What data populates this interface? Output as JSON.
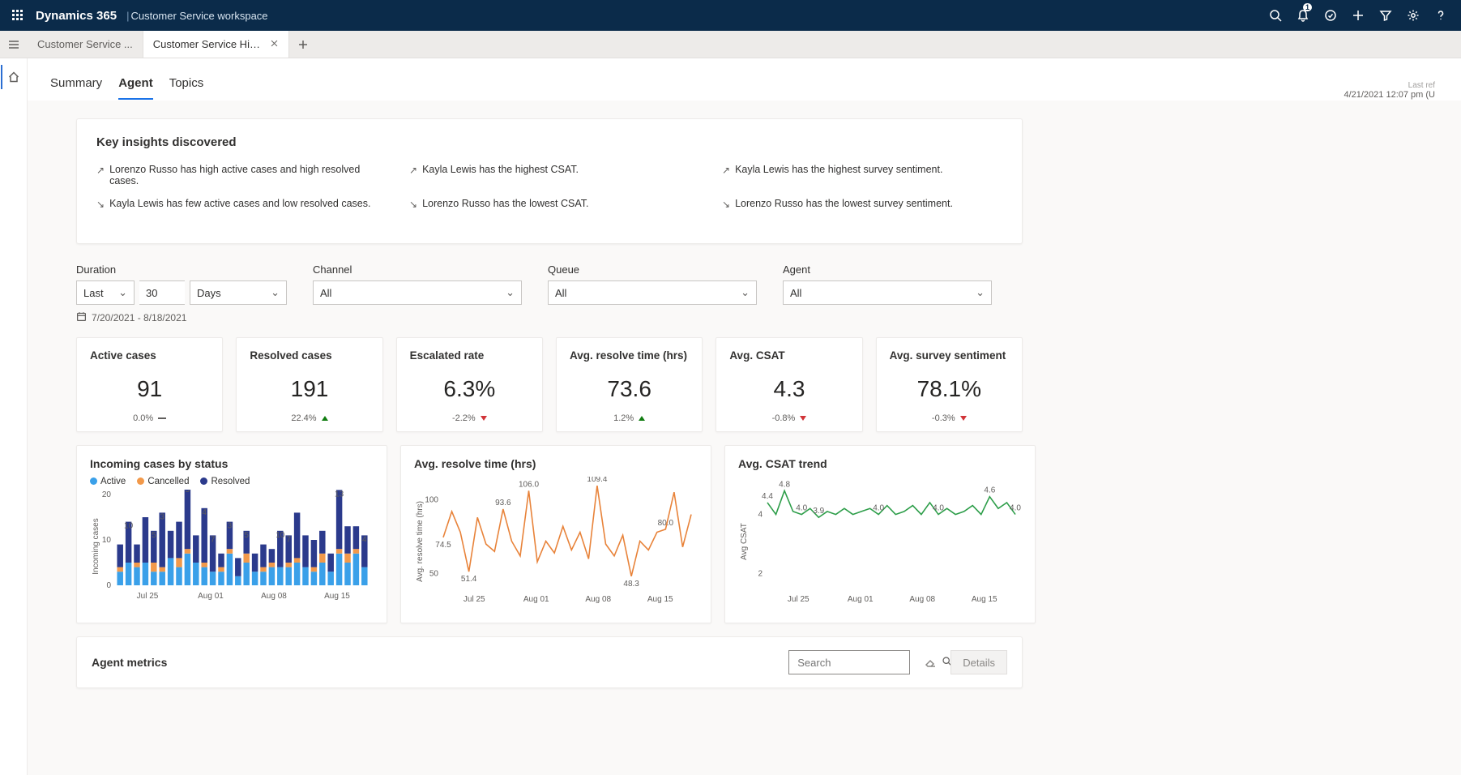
{
  "topbar": {
    "brand": "Dynamics 365",
    "context": "Customer Service workspace",
    "notification_count": "1"
  },
  "tabs": {
    "t0": "Customer Service ...",
    "t1": "Customer Service Historical..."
  },
  "subtabs": {
    "summary": "Summary",
    "agent": "Agent",
    "topics": "Topics"
  },
  "last_refresh": {
    "label": "Last ref",
    "value": "4/21/2021 12:07 pm (U"
  },
  "insights": {
    "title": "Key insights discovered",
    "items": [
      {
        "dir": "up",
        "text": "Lorenzo Russo has high active cases and high resolved cases."
      },
      {
        "dir": "up",
        "text": "Kayla Lewis has the highest CSAT."
      },
      {
        "dir": "up",
        "text": "Kayla Lewis has the highest survey sentiment."
      },
      {
        "dir": "down",
        "text": "Kayla Lewis has few active cases and low resolved cases."
      },
      {
        "dir": "down",
        "text": "Lorenzo Russo has the lowest CSAT."
      },
      {
        "dir": "down",
        "text": "Lorenzo Russo has the lowest survey sentiment."
      }
    ]
  },
  "filters": {
    "duration_label": "Duration",
    "duration_mode": "Last",
    "duration_value": "30",
    "duration_unit": "Days",
    "date_range": "7/20/2021 - 8/18/2021",
    "channel_label": "Channel",
    "channel_value": "All",
    "queue_label": "Queue",
    "queue_value": "All",
    "agent_label": "Agent",
    "agent_value": "All"
  },
  "kpis": [
    {
      "title": "Active cases",
      "value": "91",
      "delta": "0.0%",
      "trend": "flat"
    },
    {
      "title": "Resolved cases",
      "value": "191",
      "delta": "22.4%",
      "trend": "up"
    },
    {
      "title": "Escalated rate",
      "value": "6.3%",
      "delta": "-2.2%",
      "trend": "down"
    },
    {
      "title": "Avg. resolve time (hrs)",
      "value": "73.6",
      "delta": "1.2%",
      "trend": "up"
    },
    {
      "title": "Avg. CSAT",
      "value": "4.3",
      "delta": "-0.8%",
      "trend": "down"
    },
    {
      "title": "Avg. survey sentiment",
      "value": "78.1%",
      "delta": "-0.3%",
      "trend": "down"
    }
  ],
  "chart_titles": {
    "incoming": "Incoming cases by status",
    "resolve": "Avg. resolve time (hrs)",
    "csat": "Avg. CSAT trend"
  },
  "legend": {
    "active": "Active",
    "cancelled": "Cancelled",
    "resolved": "Resolved"
  },
  "axis_labels": {
    "incoming_y": "Incoming cases",
    "resolve_y": "Avg. resolve time (hrs)",
    "csat_y": "Avg CSAT"
  },
  "metrics": {
    "title": "Agent metrics",
    "search_placeholder": "Search",
    "details": "Details"
  },
  "chart_data": [
    {
      "id": "incoming",
      "type": "bar",
      "stacked": true,
      "xlabel": "",
      "ylabel": "Incoming cases",
      "ylim": [
        0,
        20
      ],
      "yticks": [
        0,
        10,
        20
      ],
      "xticks": [
        "Jul 25",
        "Aug 01",
        "Aug 08",
        "Aug 15"
      ],
      "colors": {
        "Active": "#3aa0e9",
        "Cancelled": "#f2994a",
        "Resolved": "#2b3a8c"
      },
      "categories": [
        "Jul 20",
        "Jul 21",
        "Jul 22",
        "Jul 23",
        "Jul 24",
        "Jul 25",
        "Jul 26",
        "Jul 27",
        "Jul 28",
        "Jul 29",
        "Jul 30",
        "Jul 31",
        "Aug 01",
        "Aug 02",
        "Aug 03",
        "Aug 04",
        "Aug 05",
        "Aug 06",
        "Aug 07",
        "Aug 08",
        "Aug 09",
        "Aug 10",
        "Aug 11",
        "Aug 12",
        "Aug 13",
        "Aug 14",
        "Aug 15",
        "Aug 16",
        "Aug 17",
        "Aug 18"
      ],
      "series": [
        {
          "name": "Active",
          "values": [
            3,
            5,
            4,
            5,
            3,
            3,
            6,
            4,
            7,
            5,
            4,
            3,
            3,
            7,
            2,
            5,
            3,
            3,
            4,
            4,
            4,
            5,
            4,
            3,
            5,
            3,
            7,
            5,
            7,
            4
          ]
        },
        {
          "name": "Cancelled",
          "values": [
            1,
            0,
            1,
            0,
            2,
            1,
            0,
            2,
            1,
            0,
            1,
            0,
            1,
            1,
            0,
            2,
            0,
            1,
            1,
            0,
            1,
            1,
            0,
            1,
            2,
            0,
            1,
            2,
            1,
            0
          ]
        },
        {
          "name": "Resolved",
          "values": [
            5,
            9,
            4,
            10,
            7,
            12,
            6,
            8,
            14,
            6,
            12,
            8,
            3,
            6,
            4,
            5,
            4,
            5,
            3,
            8,
            6,
            10,
            7,
            6,
            5,
            4,
            13,
            6,
            5,
            7
          ]
        }
      ],
      "bar_labels": [
        null,
        "10",
        null,
        null,
        "5",
        "3",
        null,
        null,
        "5",
        null,
        "4",
        "7",
        null,
        "3",
        null,
        "5",
        null,
        null,
        null,
        "10",
        "7",
        null,
        null,
        null,
        null,
        null,
        "13",
        null,
        null,
        "4"
      ]
    },
    {
      "id": "resolve",
      "type": "line",
      "xlabel": "",
      "ylabel": "Avg. resolve time (hrs)",
      "ylim": [
        40,
        110
      ],
      "yticks": [
        50,
        100
      ],
      "xticks": [
        "Jul 25",
        "Aug 01",
        "Aug 08",
        "Aug 15"
      ],
      "color": "#e8833a",
      "categories": [
        "Jul 20",
        "Jul 21",
        "Jul 22",
        "Jul 23",
        "Jul 24",
        "Jul 25",
        "Jul 26",
        "Jul 27",
        "Jul 28",
        "Jul 29",
        "Jul 30",
        "Jul 31",
        "Aug 01",
        "Aug 02",
        "Aug 03",
        "Aug 04",
        "Aug 05",
        "Aug 06",
        "Aug 07",
        "Aug 08",
        "Aug 09",
        "Aug 10",
        "Aug 11",
        "Aug 12",
        "Aug 13",
        "Aug 14",
        "Aug 15",
        "Aug 16",
        "Aug 17",
        "Aug 18"
      ],
      "values": [
        74.5,
        92,
        78,
        51.4,
        88,
        70,
        65,
        93.6,
        72,
        62,
        106.0,
        58,
        72,
        64,
        82,
        66,
        78,
        60,
        109.4,
        70,
        62,
        76,
        48.3,
        72,
        66,
        78,
        80.0,
        105,
        68,
        90
      ],
      "point_labels": {
        "0": "74.5",
        "3": "51.4",
        "7": "93.6",
        "10": "106.0",
        "18": "109.4",
        "22": "48.3",
        "26": "80.0"
      }
    },
    {
      "id": "csat",
      "type": "line",
      "xlabel": "",
      "ylabel": "Avg CSAT",
      "ylim": [
        1.5,
        5
      ],
      "yticks": [
        2,
        4
      ],
      "xticks": [
        "Jul 25",
        "Aug 01",
        "Aug 08",
        "Aug 15"
      ],
      "color": "#2e9e4a",
      "categories": [
        "Jul 20",
        "Jul 21",
        "Jul 22",
        "Jul 23",
        "Jul 24",
        "Jul 25",
        "Jul 26",
        "Jul 27",
        "Jul 28",
        "Jul 29",
        "Jul 30",
        "Jul 31",
        "Aug 01",
        "Aug 02",
        "Aug 03",
        "Aug 04",
        "Aug 05",
        "Aug 06",
        "Aug 07",
        "Aug 08",
        "Aug 09",
        "Aug 10",
        "Aug 11",
        "Aug 12",
        "Aug 13",
        "Aug 14",
        "Aug 15",
        "Aug 16",
        "Aug 17",
        "Aug 18"
      ],
      "values": [
        4.4,
        4.0,
        4.8,
        4.1,
        4.0,
        4.2,
        3.9,
        4.1,
        4.0,
        4.2,
        4.0,
        4.1,
        4.2,
        4.0,
        4.3,
        4.0,
        4.1,
        4.3,
        4.0,
        4.4,
        4.0,
        4.2,
        4.0,
        4.1,
        4.3,
        4.0,
        4.6,
        4.2,
        4.4,
        4.0
      ],
      "point_labels": {
        "0": "4.4",
        "2": "4.8",
        "4": "4.0",
        "6": "3.9",
        "13": "4.0",
        "20": "4.0",
        "26": "4.6",
        "29": "4.0"
      }
    }
  ]
}
